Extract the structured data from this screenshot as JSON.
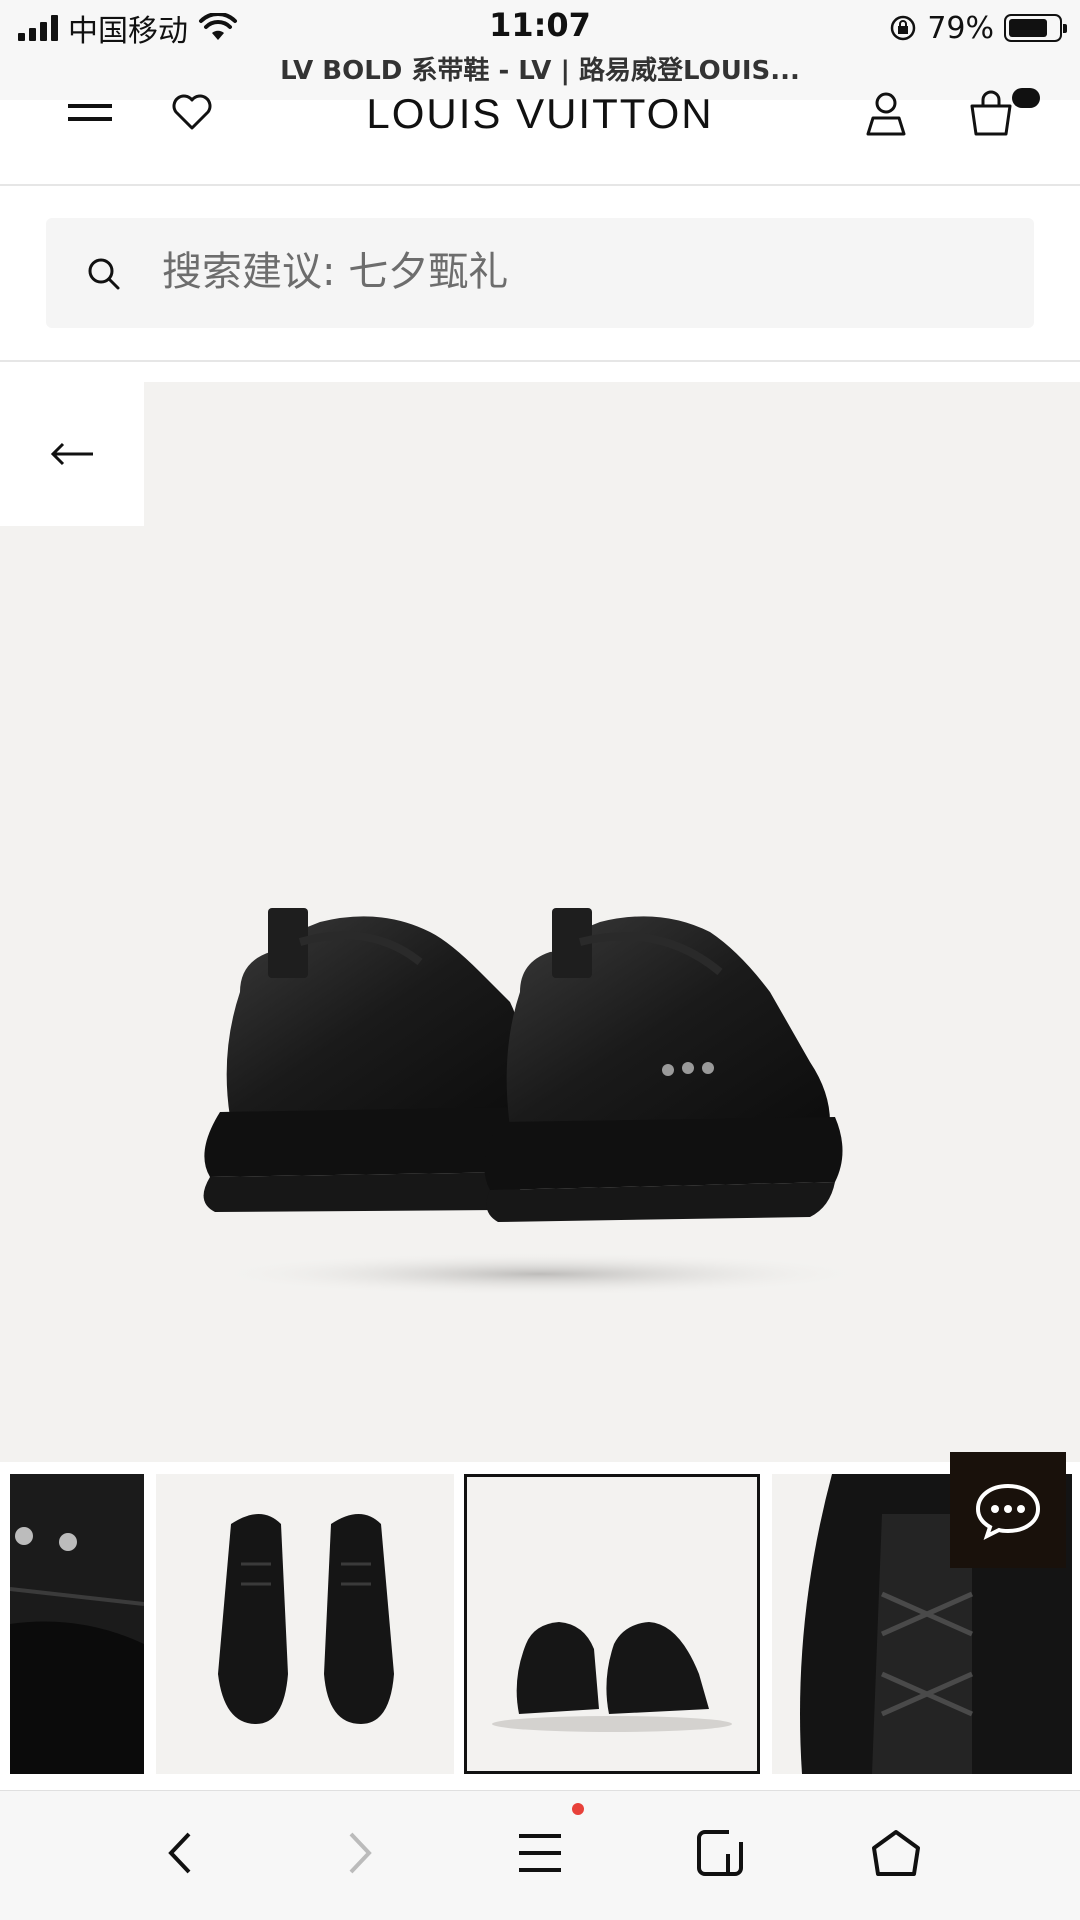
{
  "status_bar": {
    "carrier": "中国移动",
    "time": "11:07",
    "battery_percent": "79%",
    "battery_level": 0.79,
    "page_title": "LV BOLD 系带鞋 - LV | 路易威登LOUIS..."
  },
  "header": {
    "logo": "LOUIS VUITTON",
    "icons": [
      "menu-icon",
      "heart-icon",
      "account-icon",
      "shopping-bag-icon"
    ]
  },
  "search": {
    "placeholder": "搜索建议: 七夕甄礼"
  },
  "product_gallery": {
    "back_icon": "arrow-left-icon",
    "thumbnails": [
      "detail-monogram",
      "top-view",
      "rear-view",
      "lace-detail"
    ],
    "selected_thumbnail_index": 2
  },
  "chat": {
    "icon": "chat-bubble-icon"
  },
  "browser_bar": {
    "icons": [
      "back-icon",
      "forward-icon",
      "menu-icon",
      "tabs-icon",
      "home-icon"
    ],
    "notification_color": "#e8413a"
  }
}
